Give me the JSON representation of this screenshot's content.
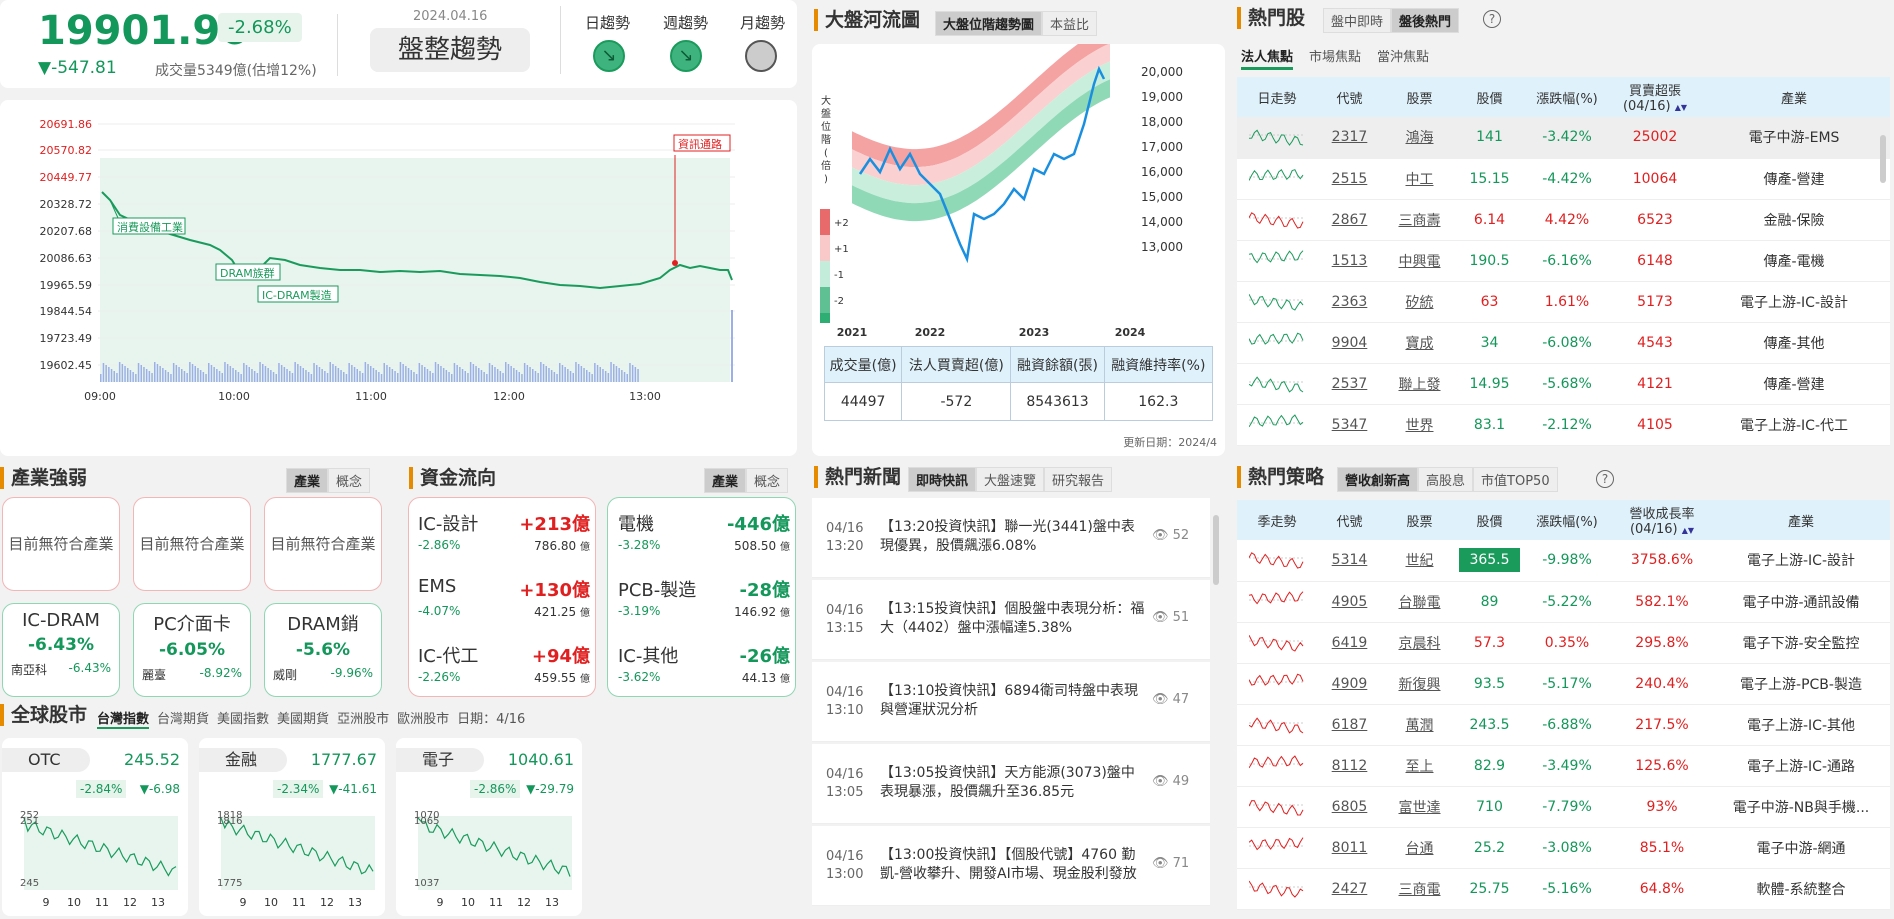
{
  "index": {
    "value": "19901.96",
    "pct": "-2.68%",
    "chg": "▼-547.81",
    "volume": "成交量5349億(估增12%)",
    "date": "2024.04.16",
    "trend": "盤整趨勢",
    "day_label": "日趨勢",
    "week_label": "週趨勢",
    "month_label": "月趨勢",
    "colors": {
      "down": "#14975a",
      "up": "#e02020",
      "accent": "#e68a00"
    }
  },
  "intraday": {
    "yticks": [
      "20691.86",
      "20570.82",
      "20449.77",
      "20328.72",
      "20207.68",
      "20086.63",
      "19965.59",
      "19844.54",
      "19723.49",
      "19602.45"
    ],
    "xticks": [
      "09:00",
      "10:00",
      "11:00",
      "12:00",
      "13:00"
    ],
    "annotations": [
      "資訊通路",
      "消費設備工業",
      "DRAM族群",
      "IC-DRAM製造"
    ]
  },
  "river": {
    "title": "大盤河流圖",
    "tab1": "大盤位階趨勢圖",
    "tab2": "本益比",
    "ylabel": "大盤位階(倍)",
    "legend": [
      "+2",
      "+1",
      "-1",
      "-2"
    ],
    "yticks": [
      "20,000",
      "19,000",
      "18,000",
      "17,000",
      "16,000",
      "15,000",
      "14,000",
      "13,000"
    ],
    "xticks": [
      "2021",
      "2022",
      "2023",
      "2024"
    ],
    "headers": [
      "成交量(億)",
      "法人買賣超(億)",
      "融資餘額(張)",
      "融資維持率(%)"
    ],
    "values": [
      "44497",
      "-572",
      "8543613",
      "162.3"
    ],
    "update": "更新日期：2024/4"
  },
  "hot": {
    "title": "熱門股",
    "tab1": "盤中即時",
    "tab2": "盤後熱門",
    "help": "?",
    "subtabs": [
      "法人焦點",
      "市場焦點",
      "當沖焦點"
    ],
    "headers": [
      "日走勢",
      "代號",
      "股票",
      "股價",
      "漲跌幅(%)",
      "買賣超張(04/16)",
      "產業"
    ],
    "sort_icon": "▲▼",
    "rows": [
      [
        "2317",
        "鴻海",
        "141",
        "-3.42%",
        "25002",
        "電子中游-EMS"
      ],
      [
        "2515",
        "中工",
        "15.15",
        "-4.42%",
        "10064",
        "傳產-營建"
      ],
      [
        "2867",
        "三商壽",
        "6.14",
        "4.42%",
        "6523",
        "金融-保險"
      ],
      [
        "1513",
        "中興電",
        "190.5",
        "-6.16%",
        "6148",
        "傳產-電機"
      ],
      [
        "2363",
        "矽統",
        "63",
        "1.61%",
        "5173",
        "電子上游-IC-設計"
      ],
      [
        "9904",
        "寶成",
        "34",
        "-6.08%",
        "4543",
        "傳產-其他"
      ],
      [
        "2537",
        "聯上發",
        "14.95",
        "-5.68%",
        "4121",
        "傳產-營建"
      ],
      [
        "5347",
        "世界",
        "83.1",
        "-2.12%",
        "4105",
        "電子上游-IC-代工"
      ]
    ]
  },
  "industry": {
    "title": "產業強弱",
    "tab1": "產業",
    "tab2": "概念",
    "empty": [
      "目前無符合產業",
      "目前無符合產業",
      "目前無符合產業"
    ],
    "items": [
      {
        "name": "IC-DRAM",
        "pct": "-6.43%",
        "stock": "南亞科",
        "spct": "-6.43%"
      },
      {
        "name": "PC介面卡",
        "pct": "-6.05%",
        "stock": "麗臺",
        "spct": "-8.92%"
      },
      {
        "name": "DRAM銷",
        "pct": "-5.6%",
        "stock": "威剛",
        "spct": "-9.96%"
      }
    ]
  },
  "flow": {
    "title": "資金流向",
    "tab1": "產業",
    "tab2": "概念",
    "unit": "億",
    "up": [
      {
        "name": "IC-設計",
        "amt": "+213億",
        "pct": "-2.86%",
        "vol": "786.80"
      },
      {
        "name": "EMS",
        "amt": "+130億",
        "pct": "-4.07%",
        "vol": "421.25"
      },
      {
        "name": "IC-代工",
        "amt": "+94億",
        "pct": "-2.26%",
        "vol": "459.55"
      }
    ],
    "down": [
      {
        "name": "電機",
        "amt": "-446億",
        "pct": "-3.28%",
        "vol": "508.50"
      },
      {
        "name": "PCB-製造",
        "amt": "-28億",
        "pct": "-3.19%",
        "vol": "146.92"
      },
      {
        "name": "IC-其他",
        "amt": "-26億",
        "pct": "-3.62%",
        "vol": "44.13"
      }
    ]
  },
  "news": {
    "title": "熱門新聞",
    "tabs": [
      "即時快訊",
      "大盤速覽",
      "研究報告"
    ],
    "items": [
      {
        "date": "04/16",
        "time": "13:20",
        "text": "【13:20投資快訊】聯一光(3441)盤中表現優異，股價飆漲6.08%",
        "views": "52"
      },
      {
        "date": "04/16",
        "time": "13:15",
        "text": "【13:15投資快訊】個股盤中表現分析：福大（4402）盤中漲幅達5.38%",
        "views": "51"
      },
      {
        "date": "04/16",
        "time": "13:10",
        "text": "【13:10投資快訊】6894衛司特盤中表現與營運狀況分析",
        "views": "47"
      },
      {
        "date": "04/16",
        "time": "13:05",
        "text": "【13:05投資快訊】天方能源(3073)盤中表現暴漲，股價飆升至36.85元",
        "views": "49"
      },
      {
        "date": "04/16",
        "time": "13:00",
        "text": "【13:00投資快訊】【個股代號】4760 勤凱-營收攀升、開發AI市場、現金股利發放",
        "views": "71"
      }
    ]
  },
  "global": {
    "title": "全球股市",
    "tabs": [
      "台灣指數",
      "台灣期貨",
      "美國指數",
      "美國期貨",
      "亞洲股市",
      "歐洲股市"
    ],
    "date": "日期：4/16",
    "cards": [
      {
        "name": "OTC",
        "value": "245.52",
        "pct": "-2.84%",
        "chg": "▼-6.98",
        "ytop": "252",
        "ymid": "251",
        "ybot": "245"
      },
      {
        "name": "金融",
        "value": "1777.67",
        "pct": "-2.34%",
        "chg": "▼-41.61",
        "ytop": "1818",
        "ymid": "1816",
        "ybot": "1775"
      },
      {
        "name": "電子",
        "value": "1040.61",
        "pct": "-2.86%",
        "chg": "▼-29.79",
        "ytop": "1070",
        "ymid": "1065",
        "ybot": "1037"
      }
    ],
    "xticks": [
      "9",
      "10",
      "11",
      "12",
      "13"
    ]
  },
  "strategy": {
    "title": "熱門策略",
    "tabs": [
      "營收創新高",
      "高股息",
      "市值TOP50"
    ],
    "help": "?",
    "headers": [
      "季走勢",
      "代號",
      "股票",
      "股價",
      "漲跌幅(%)",
      "營收成長率(04/16)",
      "產業"
    ],
    "sort_icon": "▲▼",
    "rows": [
      [
        "5314",
        "世紀",
        "365.5",
        "-9.98%",
        "3758.6%",
        "電子上游-IC-設計"
      ],
      [
        "4905",
        "台聯電",
        "89",
        "-5.22%",
        "582.1%",
        "電子中游-通訊設備"
      ],
      [
        "6419",
        "京晨科",
        "57.3",
        "0.35%",
        "295.8%",
        "電子下游-安全監控"
      ],
      [
        "4909",
        "新復興",
        "93.5",
        "-5.17%",
        "240.4%",
        "電子上游-PCB-製造"
      ],
      [
        "6187",
        "萬潤",
        "243.5",
        "-6.88%",
        "217.5%",
        "電子上游-IC-其他"
      ],
      [
        "8112",
        "至上",
        "82.9",
        "-3.49%",
        "125.6%",
        "電子上游-IC-通路"
      ],
      [
        "6805",
        "富世達",
        "710",
        "-7.79%",
        "93%",
        "電子中游-NB與手機..."
      ],
      [
        "8011",
        "台通",
        "25.2",
        "-3.08%",
        "85.1%",
        "電子中游-網通"
      ],
      [
        "2427",
        "三商電",
        "25.75",
        "-5.16%",
        "64.8%",
        "軟體-系統整合"
      ]
    ]
  }
}
